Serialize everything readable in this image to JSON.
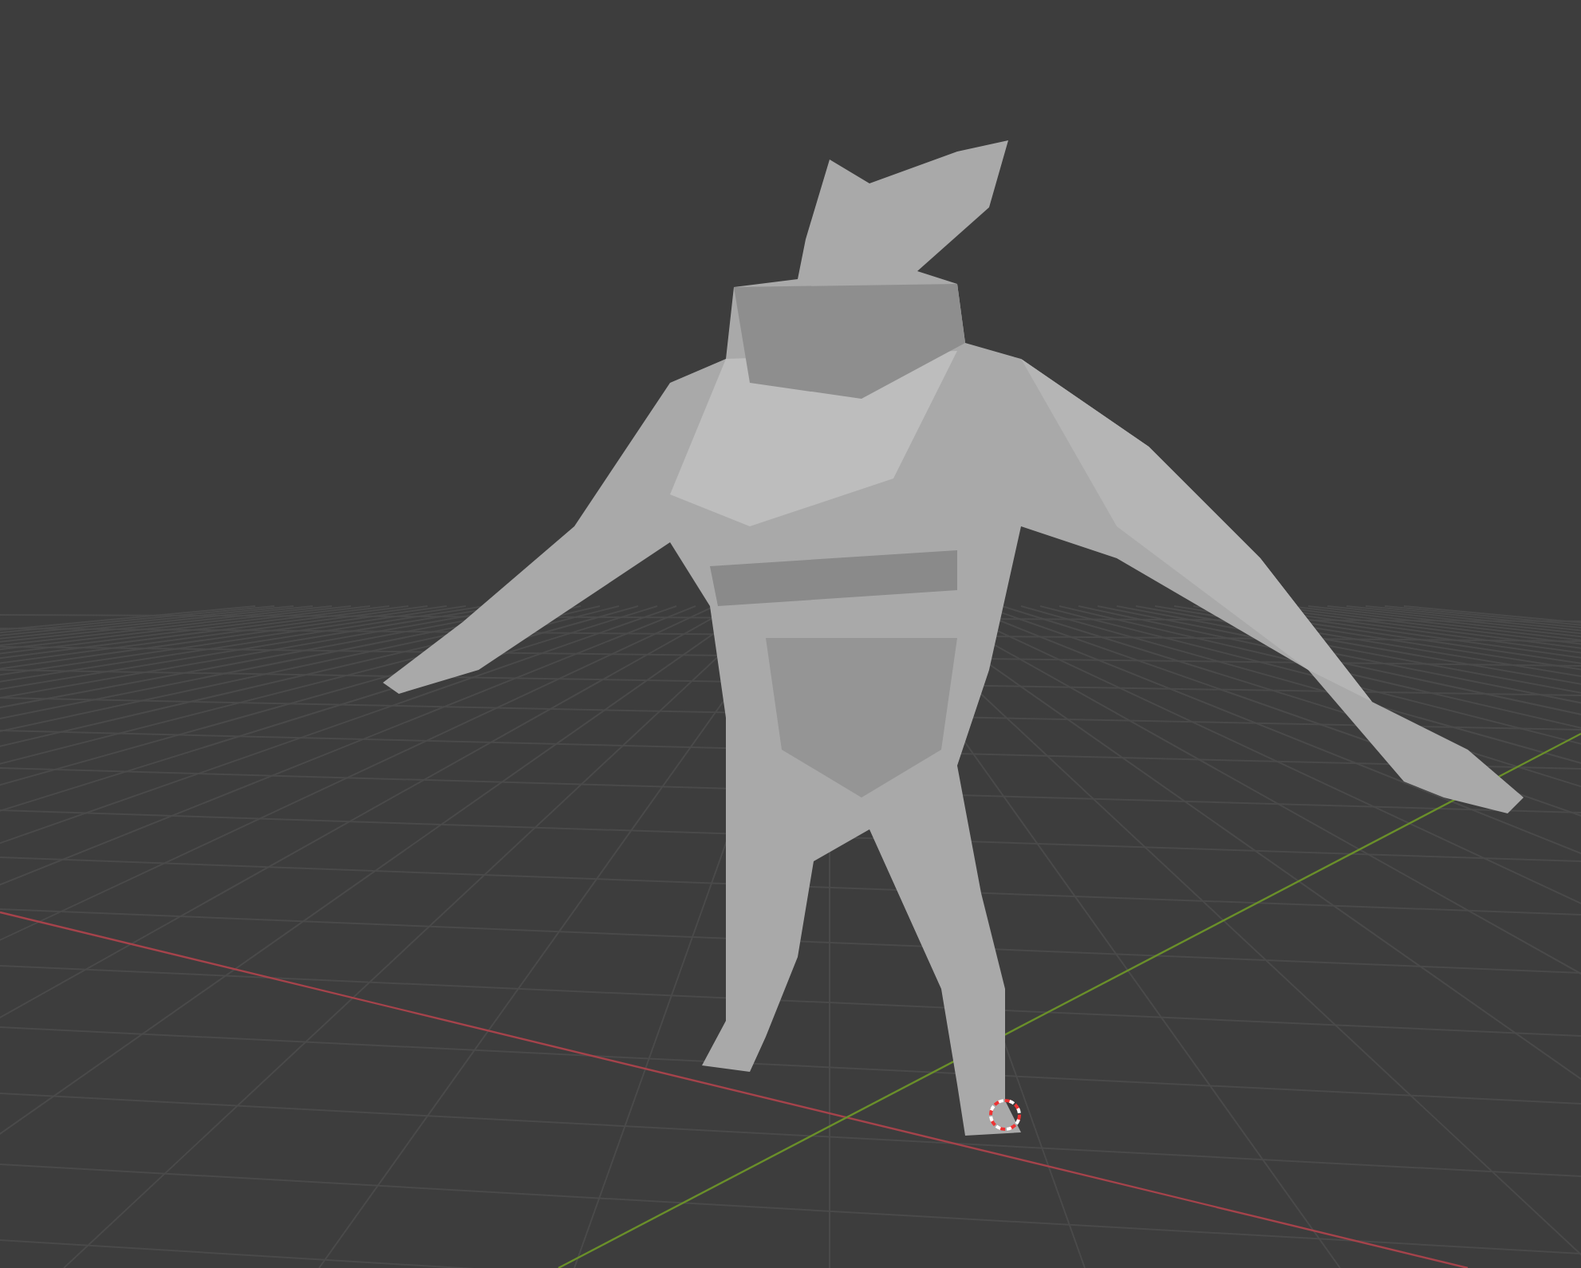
{
  "viewport": {
    "show_grid": true,
    "show_axes": true,
    "show_3d_cursor": true
  }
}
